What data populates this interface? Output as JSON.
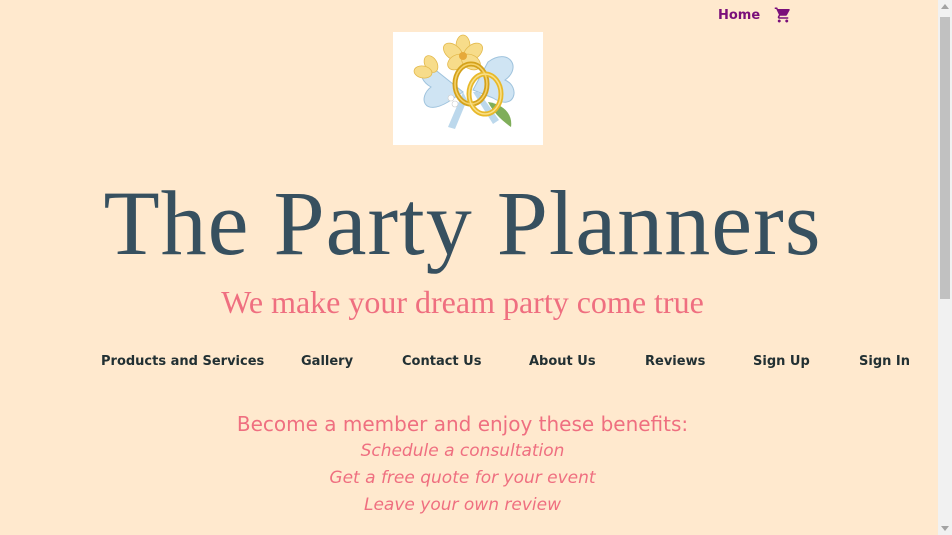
{
  "topnav": {
    "home_label": "Home",
    "cart_icon": "shopping-cart-icon"
  },
  "logo": {
    "icon": "wedding-rings-logo"
  },
  "header": {
    "title": "The Party Planners",
    "tagline": "We make your dream party come true"
  },
  "nav": {
    "items": [
      {
        "label": "Products and Services"
      },
      {
        "label": "Gallery"
      },
      {
        "label": "Contact Us"
      },
      {
        "label": "About Us"
      },
      {
        "label": "Reviews"
      },
      {
        "label": "Sign Up"
      },
      {
        "label": "Sign In"
      }
    ]
  },
  "benefits": {
    "heading": "Become a member and enjoy these benefits:",
    "items": [
      "Schedule a consultation",
      "Get a free quote for your event",
      "Leave your own review"
    ]
  },
  "colors": {
    "background": "#ffe9ce",
    "title": "#37505f",
    "accent_pink": "#ef6f80",
    "home_link": "#7a0f7a",
    "nav_text": "#223033"
  }
}
